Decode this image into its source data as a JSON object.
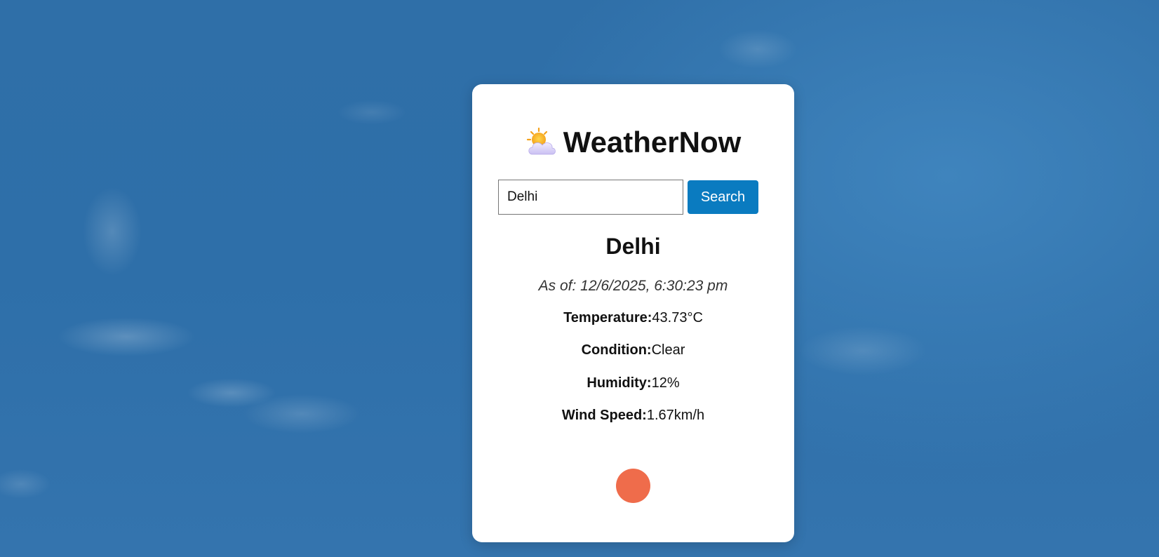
{
  "app": {
    "title": "WeatherNow",
    "title_icon": "sun-behind-cloud-icon"
  },
  "search": {
    "value": "Delhi",
    "placeholder": "",
    "button_label": "Search"
  },
  "weather": {
    "city": "Delhi",
    "as_of": "As of: 12/6/2025, 6:30:23 pm",
    "temperature_label": "Temperature:",
    "temperature_value": "43.73°C",
    "condition_label": "Condition:",
    "condition_value": "Clear",
    "humidity_label": "Humidity:",
    "humidity_value": "12%",
    "wind_label": "Wind Speed:",
    "wind_value": "1.67km/h"
  },
  "colors": {
    "background": "#2f6fa8",
    "card": "#ffffff",
    "button": "#0a7bc0",
    "loader": "#ef6c4b"
  }
}
